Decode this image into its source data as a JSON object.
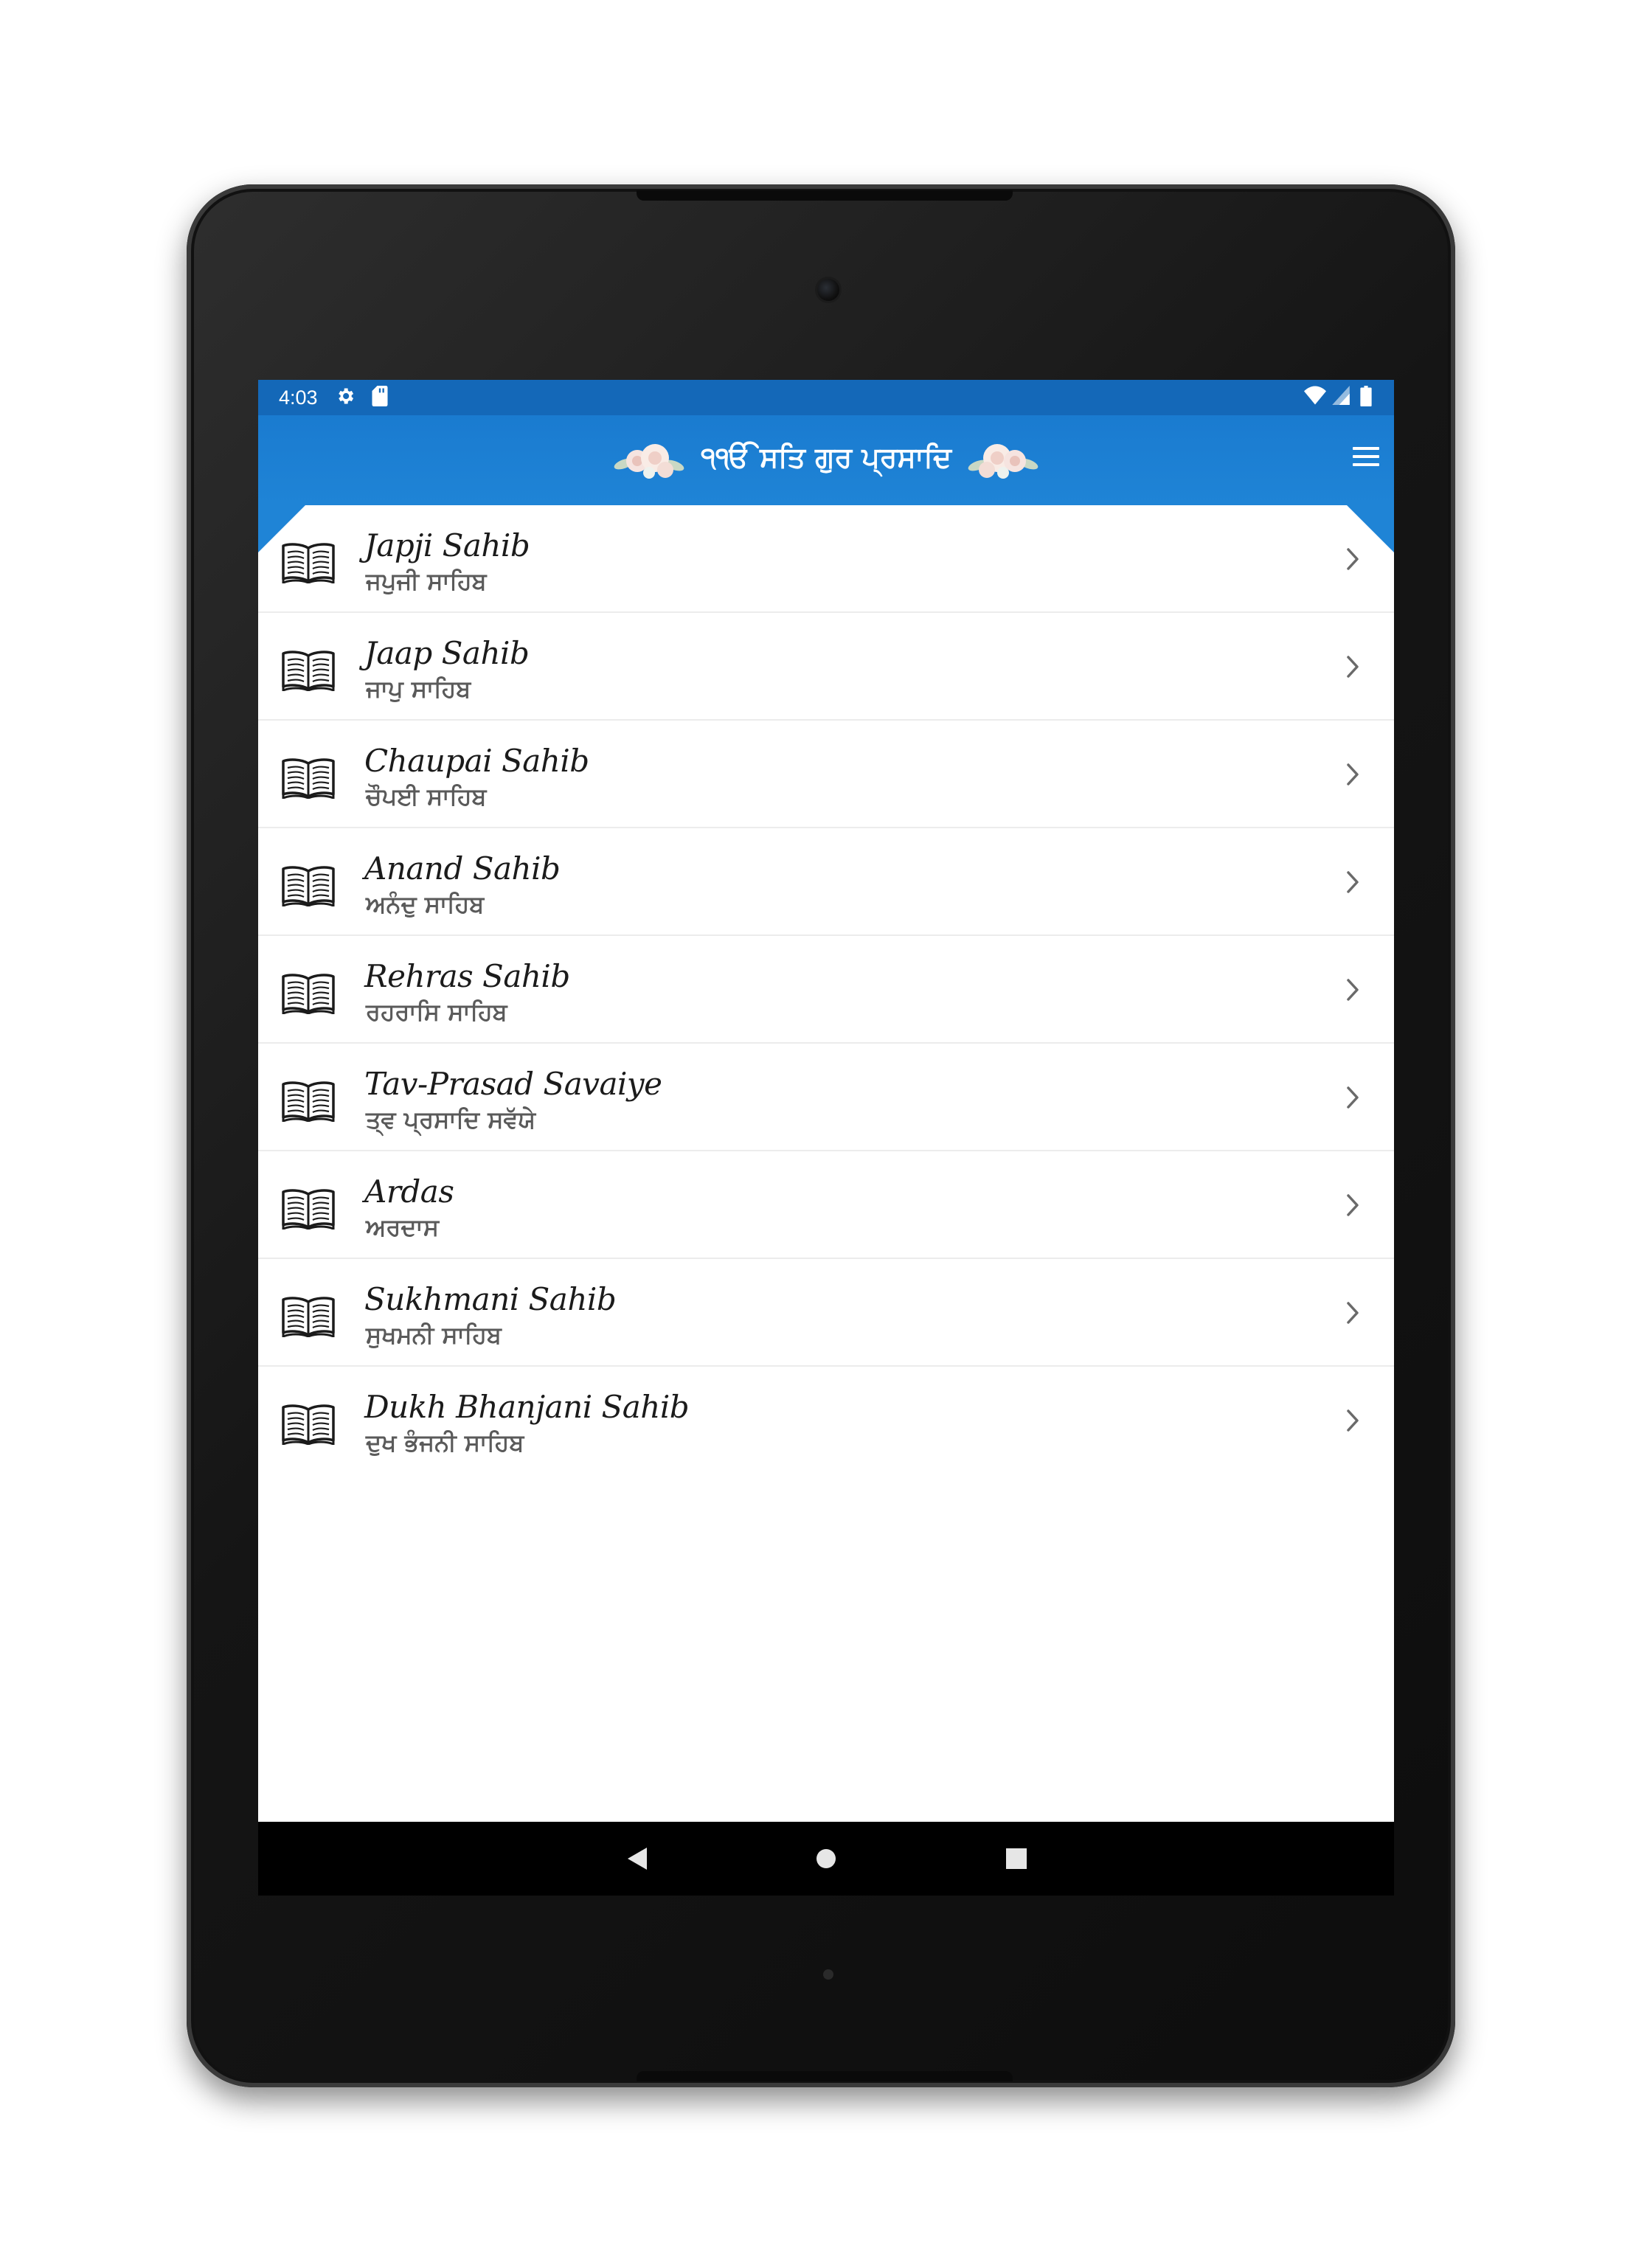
{
  "status_bar": {
    "time": "4:03",
    "icons": [
      "settings-icon",
      "sd-card-icon",
      "wifi-icon",
      "signal-icon",
      "battery-icon"
    ]
  },
  "app_bar": {
    "title": "੧ੴ ਸਤਿ ਗੁਰ ਪ੍ਰਸਾਦਿ",
    "menu_icon": "hamburger-menu-icon",
    "color": "#1f84d6"
  },
  "list": {
    "items": [
      {
        "title": "Japji Sahib",
        "subtitle": "ਜਪੁਜੀ ਸਾਹਿਬ"
      },
      {
        "title": "Jaap Sahib",
        "subtitle": "ਜਾਪੁ ਸਾਹਿਬ"
      },
      {
        "title": "Chaupai Sahib",
        "subtitle": "ਚੌਪਈ ਸਾਹਿਬ"
      },
      {
        "title": "Anand Sahib",
        "subtitle": "ਅਨੰਦੁ ਸਾਹਿਬ"
      },
      {
        "title": "Rehras Sahib",
        "subtitle": "ਰਹਰਾਸਿ ਸਾਹਿਬ"
      },
      {
        "title": "Tav-Prasad Savaiye",
        "subtitle": "ਤ੍ਵ ਪ੍ਰਸਾਦਿ ਸਵੱਯੇ"
      },
      {
        "title": "Ardas",
        "subtitle": "ਅਰਦਾਸ"
      },
      {
        "title": "Sukhmani Sahib",
        "subtitle": "ਸੁਖਮਨੀ ਸਾਹਿਬ"
      },
      {
        "title": "Dukh Bhanjani Sahib",
        "subtitle": "ਦੁਖ ਭੰਜਨੀ ਸਾਹਿਬ"
      }
    ]
  },
  "nav_bar": {
    "buttons": [
      "back-icon",
      "home-icon",
      "recents-icon"
    ]
  }
}
